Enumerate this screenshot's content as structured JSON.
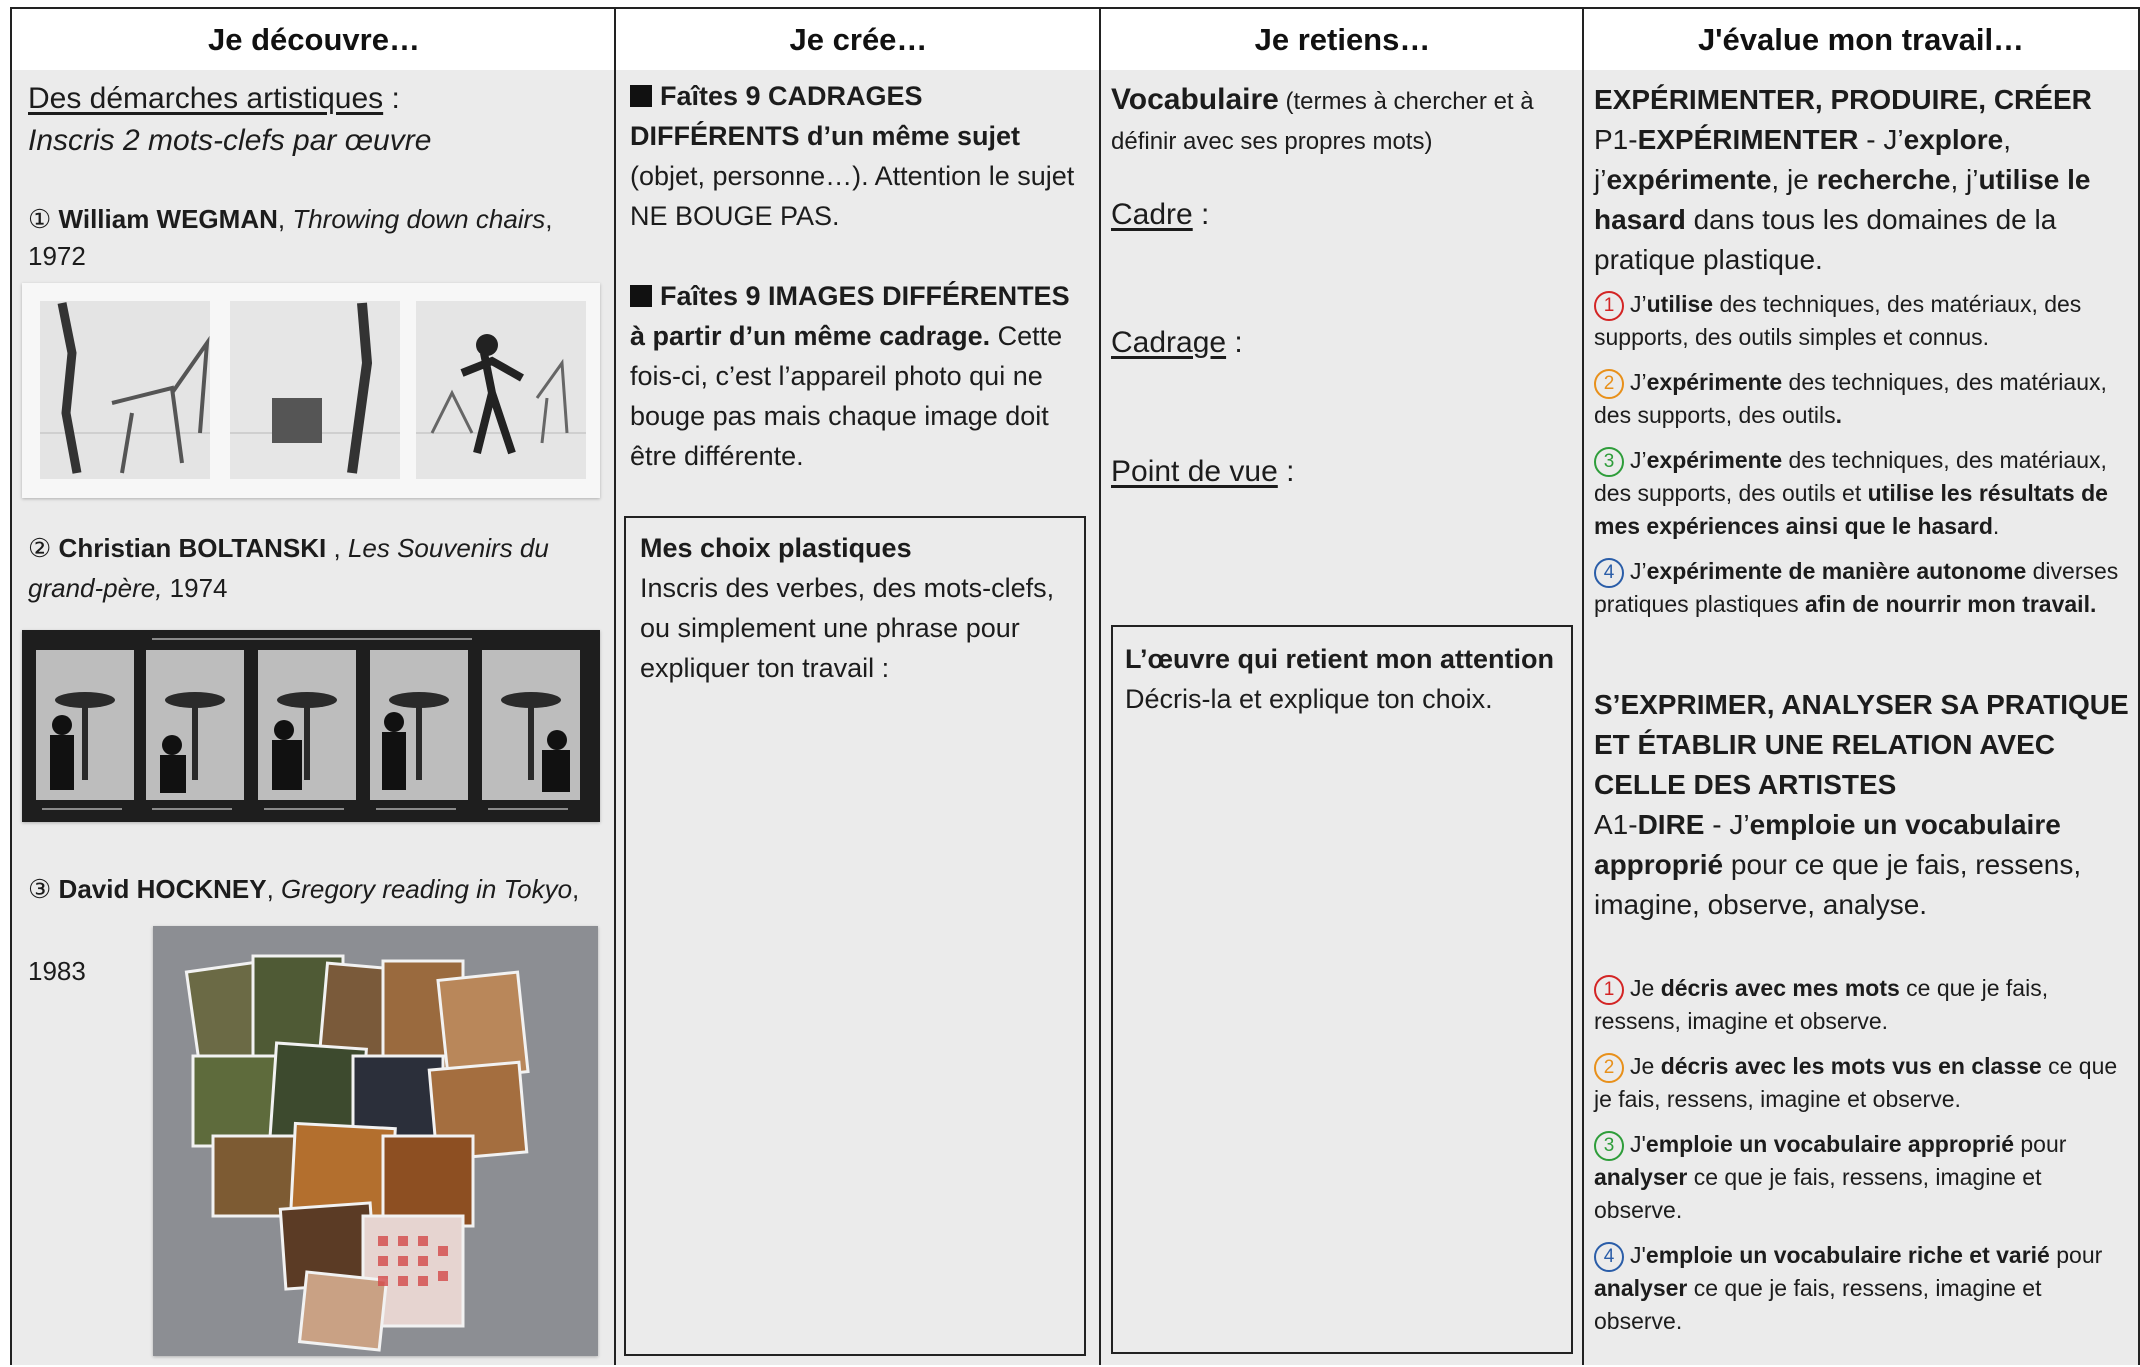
{
  "headers": [
    "Je découvre…",
    "Je crée…",
    "Je retiens…",
    "J'évalue mon travail…"
  ],
  "discover": {
    "intro_title": "Des démarches artistiques",
    "intro_colon": " :",
    "intro_sub": "Inscris 2 mots-clefs par œuvre",
    "works": [
      {
        "num": "①",
        "artist": "William WEGMAN",
        "title": "Throwing down chairs",
        "year": "1972"
      },
      {
        "num": "②",
        "artist": "Christian BOLTANSKI",
        "title": "Les Souvenirs du grand-père,",
        "year": "1974"
      },
      {
        "num": "③",
        "artist": "David HOCKNEY",
        "title": "Gregory reading in Tokyo",
        "year": "1983"
      }
    ]
  },
  "create": {
    "task1_bold": "Faîtes 9 CADRAGES DIFFÉRENTS d’un même sujet",
    "task1_rest": "(objet, personne…). Attention le sujet NE BOUGE PAS.",
    "task2_bold": "Faîtes 9 IMAGES DIFFÉRENTES à partir d’un même cadrage.",
    "task2_rest": "Cette fois-ci, c’est l’appareil photo qui ne bouge pas mais chaque image doit être différente.",
    "box_title": "Mes choix plastiques",
    "box_text": "Inscris des verbes, des mots-clefs, ou simplement une phrase pour expliquer ton travail :"
  },
  "retain": {
    "vocab_bold": "Vocabulaire",
    "vocab_rest": " (termes à chercher et à définir avec ses propres mots)",
    "terms": [
      "Cadre",
      "Cadrage",
      "Point de vue"
    ],
    "term_suffix": " :",
    "box_title": "L’œuvre qui retient mon attention",
    "box_text": "Décris-la et explique ton choix."
  },
  "evaluate": {
    "section1_title": "EXPÉRIMENTER, PRODUIRE, CRÉER",
    "p1_prefix": "P1-",
    "p1_label": "EXPÉRIMENTER",
    "p1_dash": " - J’",
    "p1_w1": "explore",
    "p1_t1": ", j’",
    "p1_w2": "expérimente",
    "p1_t2": ", je ",
    "p1_w3": "recherche",
    "p1_t3": ", j’",
    "p1_w4": "utilise le hasard",
    "p1_t4": " dans tous les domaines de la pratique plastique.",
    "levels1": [
      {
        "n": "1",
        "a": "J’",
        "b": "utilise",
        "c": " des techniques, des matériaux, des supports, des outils simples et connus.",
        "d": "",
        "e": ""
      },
      {
        "n": "2",
        "a": "J’",
        "b": "expérimente",
        "c": " des techniques, des matériaux, des supports, des outils",
        "d": ".",
        "e": ""
      },
      {
        "n": "3",
        "a": "J’",
        "b": "expérimente",
        "c": " des techniques, des matériaux, des supports, des outils et ",
        "d": "utilise les résultats de mes expériences ainsi que le hasard",
        "e": "."
      },
      {
        "n": "4",
        "a": "J’",
        "b": "expérimente de manière autonome",
        "c": " diverses pratiques plastiques ",
        "d": "afin de nourrir mon travail.",
        "e": ""
      }
    ],
    "section2_title": "S’EXPRIMER, ANALYSER SA PRATIQUE ET ÉTABLIR UNE RELATION AVEC CELLE DES ARTISTES",
    "a1_prefix": "A1-",
    "a1_label": "DIRE",
    "a1_dash": " - J’",
    "a1_bold": "emploie un vocabulaire approprié",
    "a1_rest": " pour ce que je fais, ressens, imagine, observe, analyse.",
    "levels2": [
      {
        "n": "1",
        "a": "Je ",
        "b": "décris avec mes mots",
        "c": " ce que je fais, ressens, imagine et observe.",
        "d": "",
        "e": ""
      },
      {
        "n": "2",
        "a": "Je ",
        "b": "décris avec les mots vus en classe",
        "c": " ce que je fais, ressens, imagine et observe.",
        "d": "",
        "e": ""
      },
      {
        "n": "3",
        "a": "J'",
        "b": "emploie un vocabulaire approprié",
        "c": " pour ",
        "d": "analyser",
        "e": " ce que je fais, ressens, imagine et observe."
      },
      {
        "n": "4",
        "a": "J'",
        "b": "emploie un vocabulaire riche et varié",
        "c": " pour ",
        "d": "analyser",
        "e": " ce que je fais, ressens, imagine et observe."
      }
    ],
    "level_colors": [
      "#d32424",
      "#e8901a",
      "#2e9d3a",
      "#2a5da8"
    ]
  }
}
